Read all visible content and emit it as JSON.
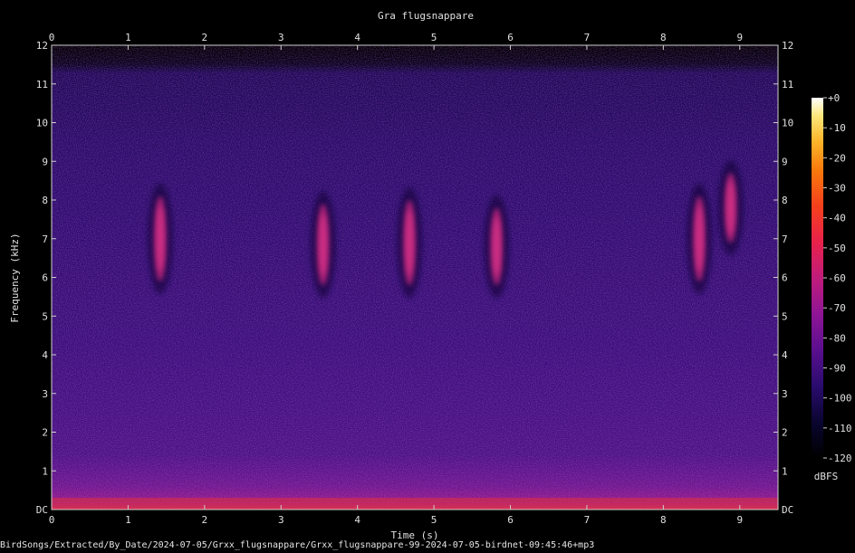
{
  "chart_data": {
    "type": "heatmap",
    "title": "Gra flugsnappare",
    "xlabel": "Time (s)",
    "ylabel": "Frequency (kHz)",
    "xlim": [
      0,
      9.5
    ],
    "ylim": [
      0,
      12
    ],
    "x_ticks": [
      "0",
      "1",
      "2",
      "3",
      "4",
      "5",
      "6",
      "7",
      "8",
      "9"
    ],
    "y_ticks": [
      "DC",
      "1",
      "2",
      "3",
      "4",
      "5",
      "6",
      "7",
      "8",
      "9",
      "10",
      "11",
      "12"
    ],
    "colorbar": {
      "label": "dBFS",
      "ticks": [
        "+0",
        "-10",
        "-20",
        "-30",
        "-40",
        "-50",
        "-60",
        "-70",
        "-80",
        "-90",
        "-100",
        "-110",
        "-120"
      ],
      "range": [
        -120,
        0
      ],
      "palette": [
        "#000000",
        "#0a0530",
        "#2a0c6e",
        "#5a0f8f",
        "#8f1595",
        "#c11c7b",
        "#e8224a",
        "#f5401c",
        "#f97a0c",
        "#fcb52b",
        "#fde77a",
        "#ffffff"
      ]
    },
    "calls": [
      {
        "t": 1.42,
        "f_low": 5.9,
        "f_high": 8.1
      },
      {
        "t": 3.55,
        "f_low": 5.8,
        "f_high": 7.9
      },
      {
        "t": 4.68,
        "f_low": 5.8,
        "f_high": 8.0
      },
      {
        "t": 5.82,
        "f_low": 5.8,
        "f_high": 7.8
      },
      {
        "t": 8.47,
        "f_low": 5.9,
        "f_high": 8.1
      },
      {
        "t": 8.88,
        "f_low": 6.9,
        "f_high": 8.7
      }
    ]
  },
  "footer": "BirdSongs/Extracted/By_Date/2024-07-05/Grxx_flugsnappare/Grxx_flugsnappare-99-2024-07-05-birdnet-09:45:46+mp3"
}
